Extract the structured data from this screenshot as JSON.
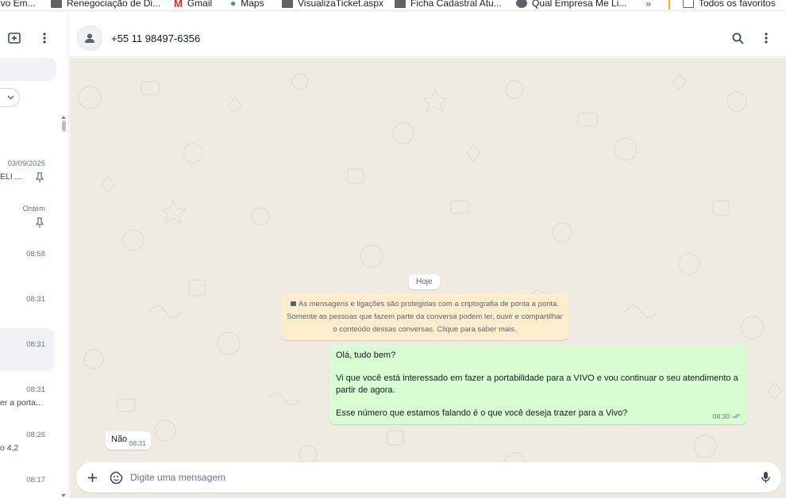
{
  "bookmarks": {
    "items": [
      {
        "label": "ivo Em...",
        "icon": "folder-icon"
      },
      {
        "label": "Renegociação de Di...",
        "icon": "folder-icon"
      },
      {
        "label": "Gmail",
        "icon": "gmail-icon"
      },
      {
        "label": "Maps",
        "icon": "maps-icon"
      },
      {
        "label": "VisualizaTicket.aspx",
        "icon": "folder-icon"
      },
      {
        "label": "Ficha Cadastral Atu...",
        "icon": "folder-icon"
      },
      {
        "label": "Qual Empresa Me Li...",
        "icon": "site-icon"
      }
    ],
    "more": "»",
    "all_favorites": "Todos os favoritos"
  },
  "sidebar": {
    "chats": [
      {
        "time": "03/09/2025",
        "snippet": "ELI ...",
        "pinned": true
      },
      {
        "time": "Ontem",
        "snippet": "",
        "pinned": true
      },
      {
        "time": "08:58",
        "snippet": ""
      },
      {
        "time": "08:31",
        "snippet": ""
      },
      {
        "time": "08:31",
        "snippet": "",
        "active": true
      },
      {
        "time": "08:31",
        "snippet": "er a porta..."
      },
      {
        "time": "08:26",
        "snippet": "o 4,2"
      },
      {
        "time": "08:17",
        "snippet": ""
      }
    ]
  },
  "header": {
    "contact": "+55 11 98497-6356"
  },
  "chat": {
    "date_chip": "Hoje",
    "encryption": {
      "line1": "As mensagens e ligações são protegidas com a criptografia de ponta a ponta.",
      "line2": "Somente as pessoas que fazem parte da conversa podem ler, ouvir e compartilhar",
      "line3": "o conteúdo dessas conversas. Clique para saber mais."
    },
    "outgoing": {
      "line1": "Olá, tudo bem?",
      "line2": "Vi que você está interessado em fazer a portabilidade para a VIVO e vou continuar o seu atendimento a",
      "line3": "partir de agora.",
      "line4": "Esse número que estamos falando é o que você deseja trazer para a Vivo?",
      "time": "08:30",
      "status_icon": "double-check-icon"
    },
    "incoming": {
      "text": "Não",
      "time": "08:31"
    }
  },
  "composer": {
    "placeholder": "Digite uma mensagem"
  },
  "colors": {
    "outgoing_bubble": "#d9fdd3",
    "chat_background": "#efeae2",
    "notice_background": "#ffeecd"
  }
}
